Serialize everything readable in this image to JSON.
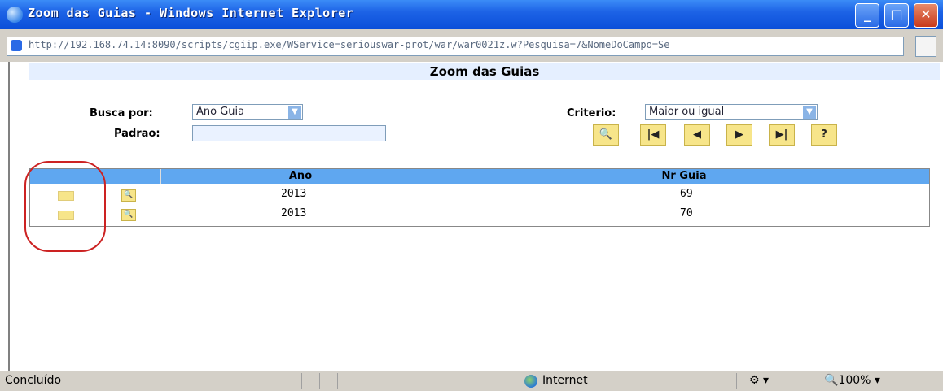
{
  "window": {
    "title": "Zoom das Guias - Windows Internet Explorer",
    "controls": {
      "minimize": "_",
      "maximize": "□",
      "close": "✕"
    }
  },
  "address": {
    "url": "http://192.168.74.14:8090/scripts/cgiip.exe/WService=seriouswar-prot/war/war0021z.w?Pesquisa=7&NomeDoCampo=Se"
  },
  "page": {
    "header": "Zoom das Guias",
    "busca_label": "Busca por:",
    "busca_value": "Ano Guia",
    "padrao_label": "Padrao:",
    "padrao_value": "",
    "criterio_label": "Criterio:",
    "criterio_value": "Maior ou igual",
    "nav_buttons": [
      "🔍",
      "|◀",
      "◀",
      "▶",
      "▶|",
      "?"
    ]
  },
  "table": {
    "headers": [
      "",
      "Ano",
      "Nr Guia"
    ],
    "rows": [
      {
        "ano": "2013",
        "nr_guia": "69"
      },
      {
        "ano": "2013",
        "nr_guia": "70"
      }
    ]
  },
  "statusbar": {
    "status": "Concluído",
    "zone": "Internet",
    "zoom": "100%"
  },
  "colors": {
    "titlebar": "#1d63e6",
    "table_header": "#5fa7f0",
    "button_yellow": "#f7e58a",
    "annotation_red": "#cc2222"
  }
}
